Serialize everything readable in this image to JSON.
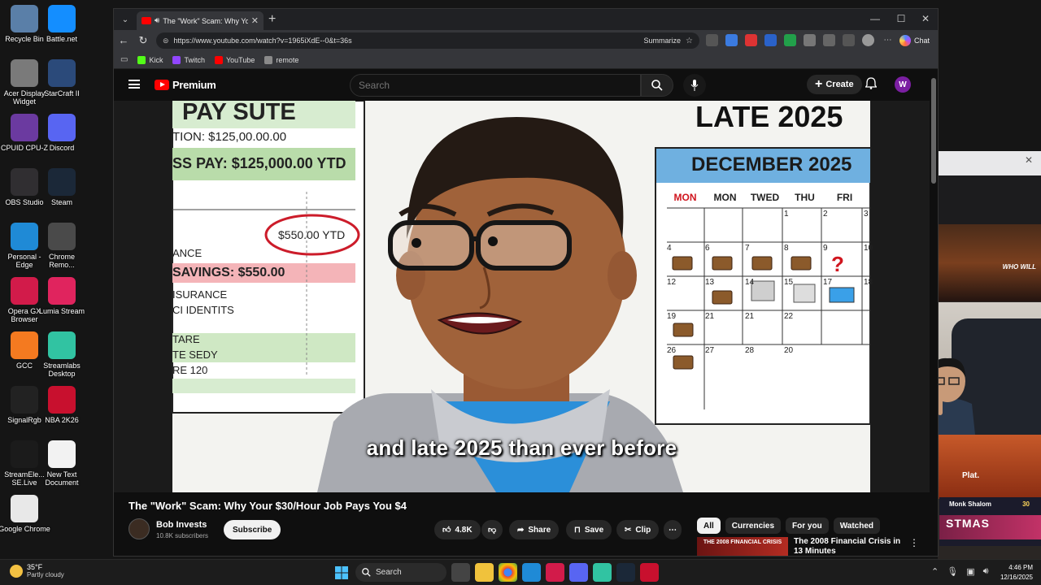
{
  "desktop": {
    "icons": [
      {
        "label": "Recycle Bin",
        "icon": "recycle-bin-icon",
        "color": "#5a7fa8"
      },
      {
        "label": "Battle.net",
        "icon": "battlenet-icon",
        "color": "#148eff"
      },
      {
        "label": "Acer Display Widget",
        "icon": "acer-display-icon",
        "color": "#7a7a7a"
      },
      {
        "label": "StarCraft II",
        "icon": "starcraft-icon",
        "color": "#2b4a7a"
      },
      {
        "label": "CPUID CPU-Z",
        "icon": "cpuz-icon",
        "color": "#6b3aa0"
      },
      {
        "label": "Discord",
        "icon": "discord-icon",
        "color": "#5865f2"
      },
      {
        "label": "OBS Studio",
        "icon": "obs-icon",
        "color": "#302e31"
      },
      {
        "label": "Steam",
        "icon": "steam-icon",
        "color": "#1b2838"
      },
      {
        "label": "Personal - Edge",
        "icon": "edge-icon",
        "color": "#1f8ad6"
      },
      {
        "label": "Chrome Remo...",
        "icon": "chrome-remote-icon",
        "color": "#4a4a4a"
      },
      {
        "label": "Opera GX Browser",
        "icon": "opera-gx-icon",
        "color": "#d21b4a"
      },
      {
        "label": "Lumia Stream",
        "icon": "lumia-icon",
        "color": "#e0245e"
      },
      {
        "label": "GCC",
        "icon": "gcc-icon",
        "color": "#f47a20"
      },
      {
        "label": "Streamlabs Desktop",
        "icon": "streamlabs-icon",
        "color": "#31c3a2"
      },
      {
        "label": "SignalRgb",
        "icon": "signalrgb-icon",
        "color": "#222"
      },
      {
        "label": "NBA 2K26",
        "icon": "nba2k-icon",
        "color": "#c8102e"
      },
      {
        "label": "StreamEle... SE.Live",
        "icon": "streamelements-icon",
        "color": "#1b1b1b"
      },
      {
        "label": "New Text Document",
        "icon": "text-document-icon",
        "color": "#f2f2f2"
      },
      {
        "label": "Google Chrome",
        "icon": "chrome-icon",
        "color": "#e8e8e8"
      }
    ]
  },
  "browser": {
    "tab_title": "The \"Work\" Scam: Why Your $",
    "url": "https://www.youtube.com/watch?v=1965iXdE--0&t=36s",
    "summarize_label": "Summarize",
    "chat_label": "Chat",
    "bookmarks": [
      {
        "label": "Kick",
        "color": "#53fc18"
      },
      {
        "label": "Twitch",
        "color": "#9146ff"
      },
      {
        "label": "YouTube",
        "color": "#ff0000"
      },
      {
        "label": "remote",
        "color": "#8a8a8a"
      }
    ]
  },
  "youtube": {
    "logo_text": "Premium",
    "search_placeholder": "Search",
    "create_label": "Create",
    "avatar_letter": "W",
    "caption": "and late 2025 than ever before",
    "video_title": "The \"Work\" Scam: Why Your $30/Hour Job Pays You $4",
    "channel_name": "Bob Invests",
    "subscribers": "10.8K subscribers",
    "subscribe_label": "Subscribe",
    "likes": "4.8K",
    "share_label": "Share",
    "save_label": "Save",
    "clip_label": "Clip",
    "chips": [
      "All",
      "Currencies",
      "For you",
      "Watched"
    ],
    "rec_title": "The 2008 Financial Crisis in 13 Minutes",
    "rec_thumb_text": "THE 2008 FINANCIAL CRISIS"
  },
  "video_frame": {
    "pay_title": "PAY SUTE",
    "comp_line": "TION: $125,00.00.00",
    "gross_line": "SS PAY: $125,000.00 YTD",
    "ytd_oval": "$550.00 YTD",
    "ance": "ANCE",
    "savings_line": "SAVINGS: $550.00",
    "insurance": "ISURANCE",
    "identits": "CI IDENTITS",
    "tare": "TARE",
    "tesedy": "TE SEDY",
    "re120": "RE 120",
    "late": "LATE 2025",
    "cal_month": "DECEMBER 2025",
    "cal_days": [
      "MON",
      "MON",
      "TWED",
      "THU",
      "FRI"
    ],
    "cal_nums": [
      "1",
      "2",
      "3",
      "4",
      "6",
      "7",
      "8",
      "9",
      "10",
      "12",
      "13",
      "14",
      "15",
      "17",
      "18",
      "19",
      "21",
      "21",
      "22",
      "26",
      "27",
      "28",
      "20"
    ]
  },
  "stream": {
    "streamer": "Monk Shalom",
    "level": "30",
    "tag": "Plat.",
    "banner": "STMAS",
    "note": "WHO WILL"
  },
  "taskbar": {
    "temp": "35°F",
    "weather": "Partly cloudy",
    "search_label": "Search",
    "time": "4:46 PM",
    "date": "12/16/2025"
  }
}
